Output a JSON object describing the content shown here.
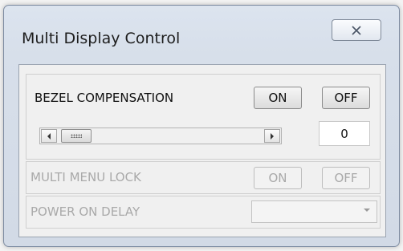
{
  "window": {
    "title": "Multi Display Control",
    "close_icon": "close-icon"
  },
  "bezel": {
    "label": "BEZEL COMPENSATION",
    "on_label": "ON",
    "off_label": "OFF",
    "value": "0"
  },
  "multi_menu_lock": {
    "label": "MULTI MENU LOCK",
    "on_label": "ON",
    "off_label": "OFF"
  },
  "power_on_delay": {
    "label": "POWER ON DELAY",
    "selected": ""
  }
}
